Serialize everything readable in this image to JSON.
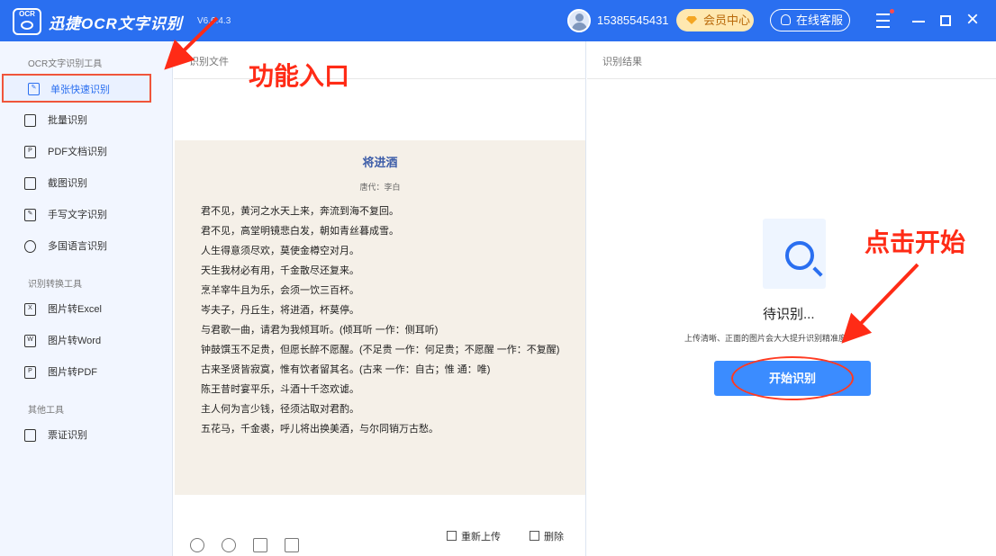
{
  "app": {
    "logo_text": "OCR",
    "title": "迅捷OCR文字识别",
    "version": "V6.6.4.3",
    "phone": "15385545431",
    "vip_label": "会员中心",
    "service_label": "在线客服"
  },
  "sidebar": {
    "groups": [
      {
        "title": "OCR文字识别工具",
        "items": [
          {
            "label": "单张快速识别",
            "icon": "document-edit-icon"
          },
          {
            "label": "批量识别",
            "icon": "stack-icon"
          },
          {
            "label": "PDF文档识别",
            "icon": "pdf-icon"
          },
          {
            "label": "截图识别",
            "icon": "crop-icon"
          },
          {
            "label": "手写文字识别",
            "icon": "pen-icon"
          },
          {
            "label": "多国语言识别",
            "icon": "globe-icon"
          }
        ]
      },
      {
        "title": "识别转换工具",
        "items": [
          {
            "label": "图片转Excel",
            "icon": "excel-icon"
          },
          {
            "label": "图片转Word",
            "icon": "word-icon"
          },
          {
            "label": "图片转PDF",
            "icon": "pdf-file-icon"
          }
        ]
      },
      {
        "title": "其他工具",
        "items": [
          {
            "label": "票证识别",
            "icon": "ticket-icon"
          }
        ]
      }
    ]
  },
  "document": {
    "header": "识别文件",
    "poem": {
      "title": "将进酒",
      "author": "唐代：李白",
      "lines": [
        "君不见，黄河之水天上来，奔流到海不复回。",
        "君不见，高堂明镜悲白发，朝如青丝暮成雪。",
        "人生得意须尽欢，莫使金樽空对月。",
        "天生我材必有用，千金散尽还复来。",
        "烹羊宰牛且为乐，会须一饮三百杯。",
        "岑夫子，丹丘生，将进酒，杯莫停。",
        "与君歌一曲，请君为我倾耳听。(倾耳听 一作：侧耳听)",
        "钟鼓馔玉不足贵，但愿长醉不愿醒。(不足贵 一作：何足贵；不愿醒 一作：不复醒)",
        "古来圣贤皆寂寞，惟有饮者留其名。(古来 一作：自古；惟 通：唯)",
        "陈王昔时宴平乐，斗酒十千恣欢谑。",
        "主人何为言少钱，径须沽取对君酌。",
        "五花马，千金裘，呼儿将出换美酒，与尔同销万古愁。"
      ]
    },
    "reupload_label": "重新上传",
    "delete_label": "删除"
  },
  "result": {
    "header": "识别结果",
    "status": "待识别...",
    "hint": "上传清晰、正面的图片会大大提升识别精准度",
    "start_label": "开始识别"
  },
  "annotations": {
    "entry": "功能入口",
    "click": "点击开始",
    "color": "#ff2b16"
  },
  "colors": {
    "primary": "#2a6ff0",
    "button": "#3b8cff",
    "sidebar_bg": "#f2f6ff",
    "paper_bg": "#f5f0e8"
  }
}
